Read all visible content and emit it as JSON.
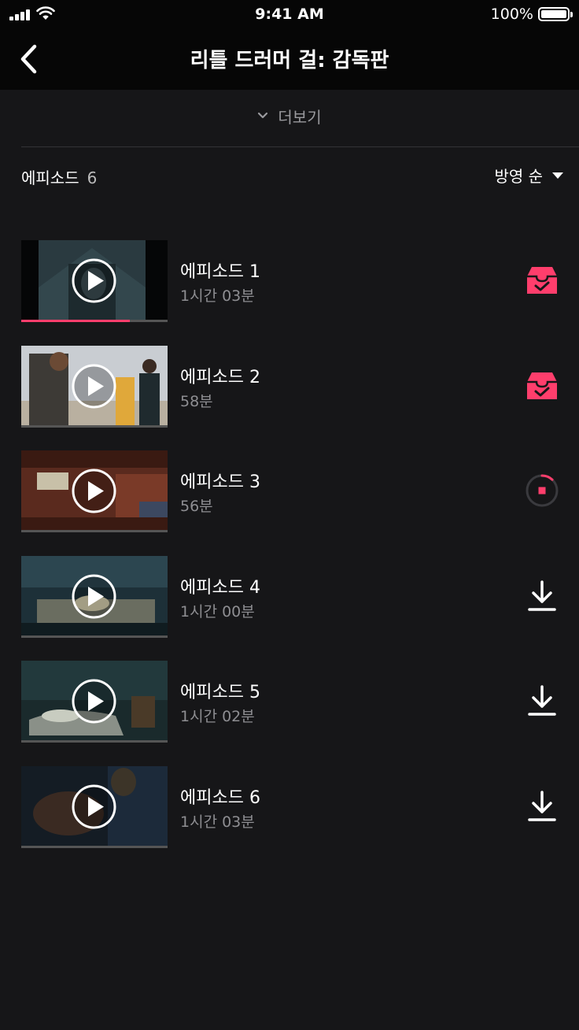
{
  "status_bar": {
    "time": "9:41 AM",
    "battery": "100%"
  },
  "nav": {
    "title": "리틀 드러머 걸: 감독판",
    "back_icon": "chevron-left-icon"
  },
  "more": {
    "label": "더보기",
    "icon": "chevron-down-icon"
  },
  "episodes_header": {
    "label": "에피소드",
    "count": "6"
  },
  "sort": {
    "label": "방영 순",
    "icon": "caret-down-icon"
  },
  "colors": {
    "accent": "#ff3e6c",
    "background": "#161618",
    "bar": "#060606"
  },
  "episodes": [
    {
      "title": "에피소드 1",
      "duration": "1시간 03분",
      "watched_fraction": 0.74,
      "status": "downloaded",
      "icon": "download-complete-icon"
    },
    {
      "title": "에피소드 2",
      "duration": "58분",
      "watched_fraction": 0,
      "status": "downloaded",
      "icon": "download-complete-icon"
    },
    {
      "title": "에피소드 3",
      "duration": "56분",
      "watched_fraction": 0,
      "status": "downloading",
      "download_fraction": 0.12,
      "icon": "download-progress-stop-icon"
    },
    {
      "title": "에피소드 4",
      "duration": "1시간 00분",
      "watched_fraction": 0,
      "status": "available",
      "icon": "download-icon"
    },
    {
      "title": "에피소드 5",
      "duration": "1시간 02분",
      "watched_fraction": 0,
      "status": "available",
      "icon": "download-icon"
    },
    {
      "title": "에피소드 6",
      "duration": "1시간 03분",
      "watched_fraction": 0,
      "status": "available",
      "icon": "download-icon"
    }
  ]
}
